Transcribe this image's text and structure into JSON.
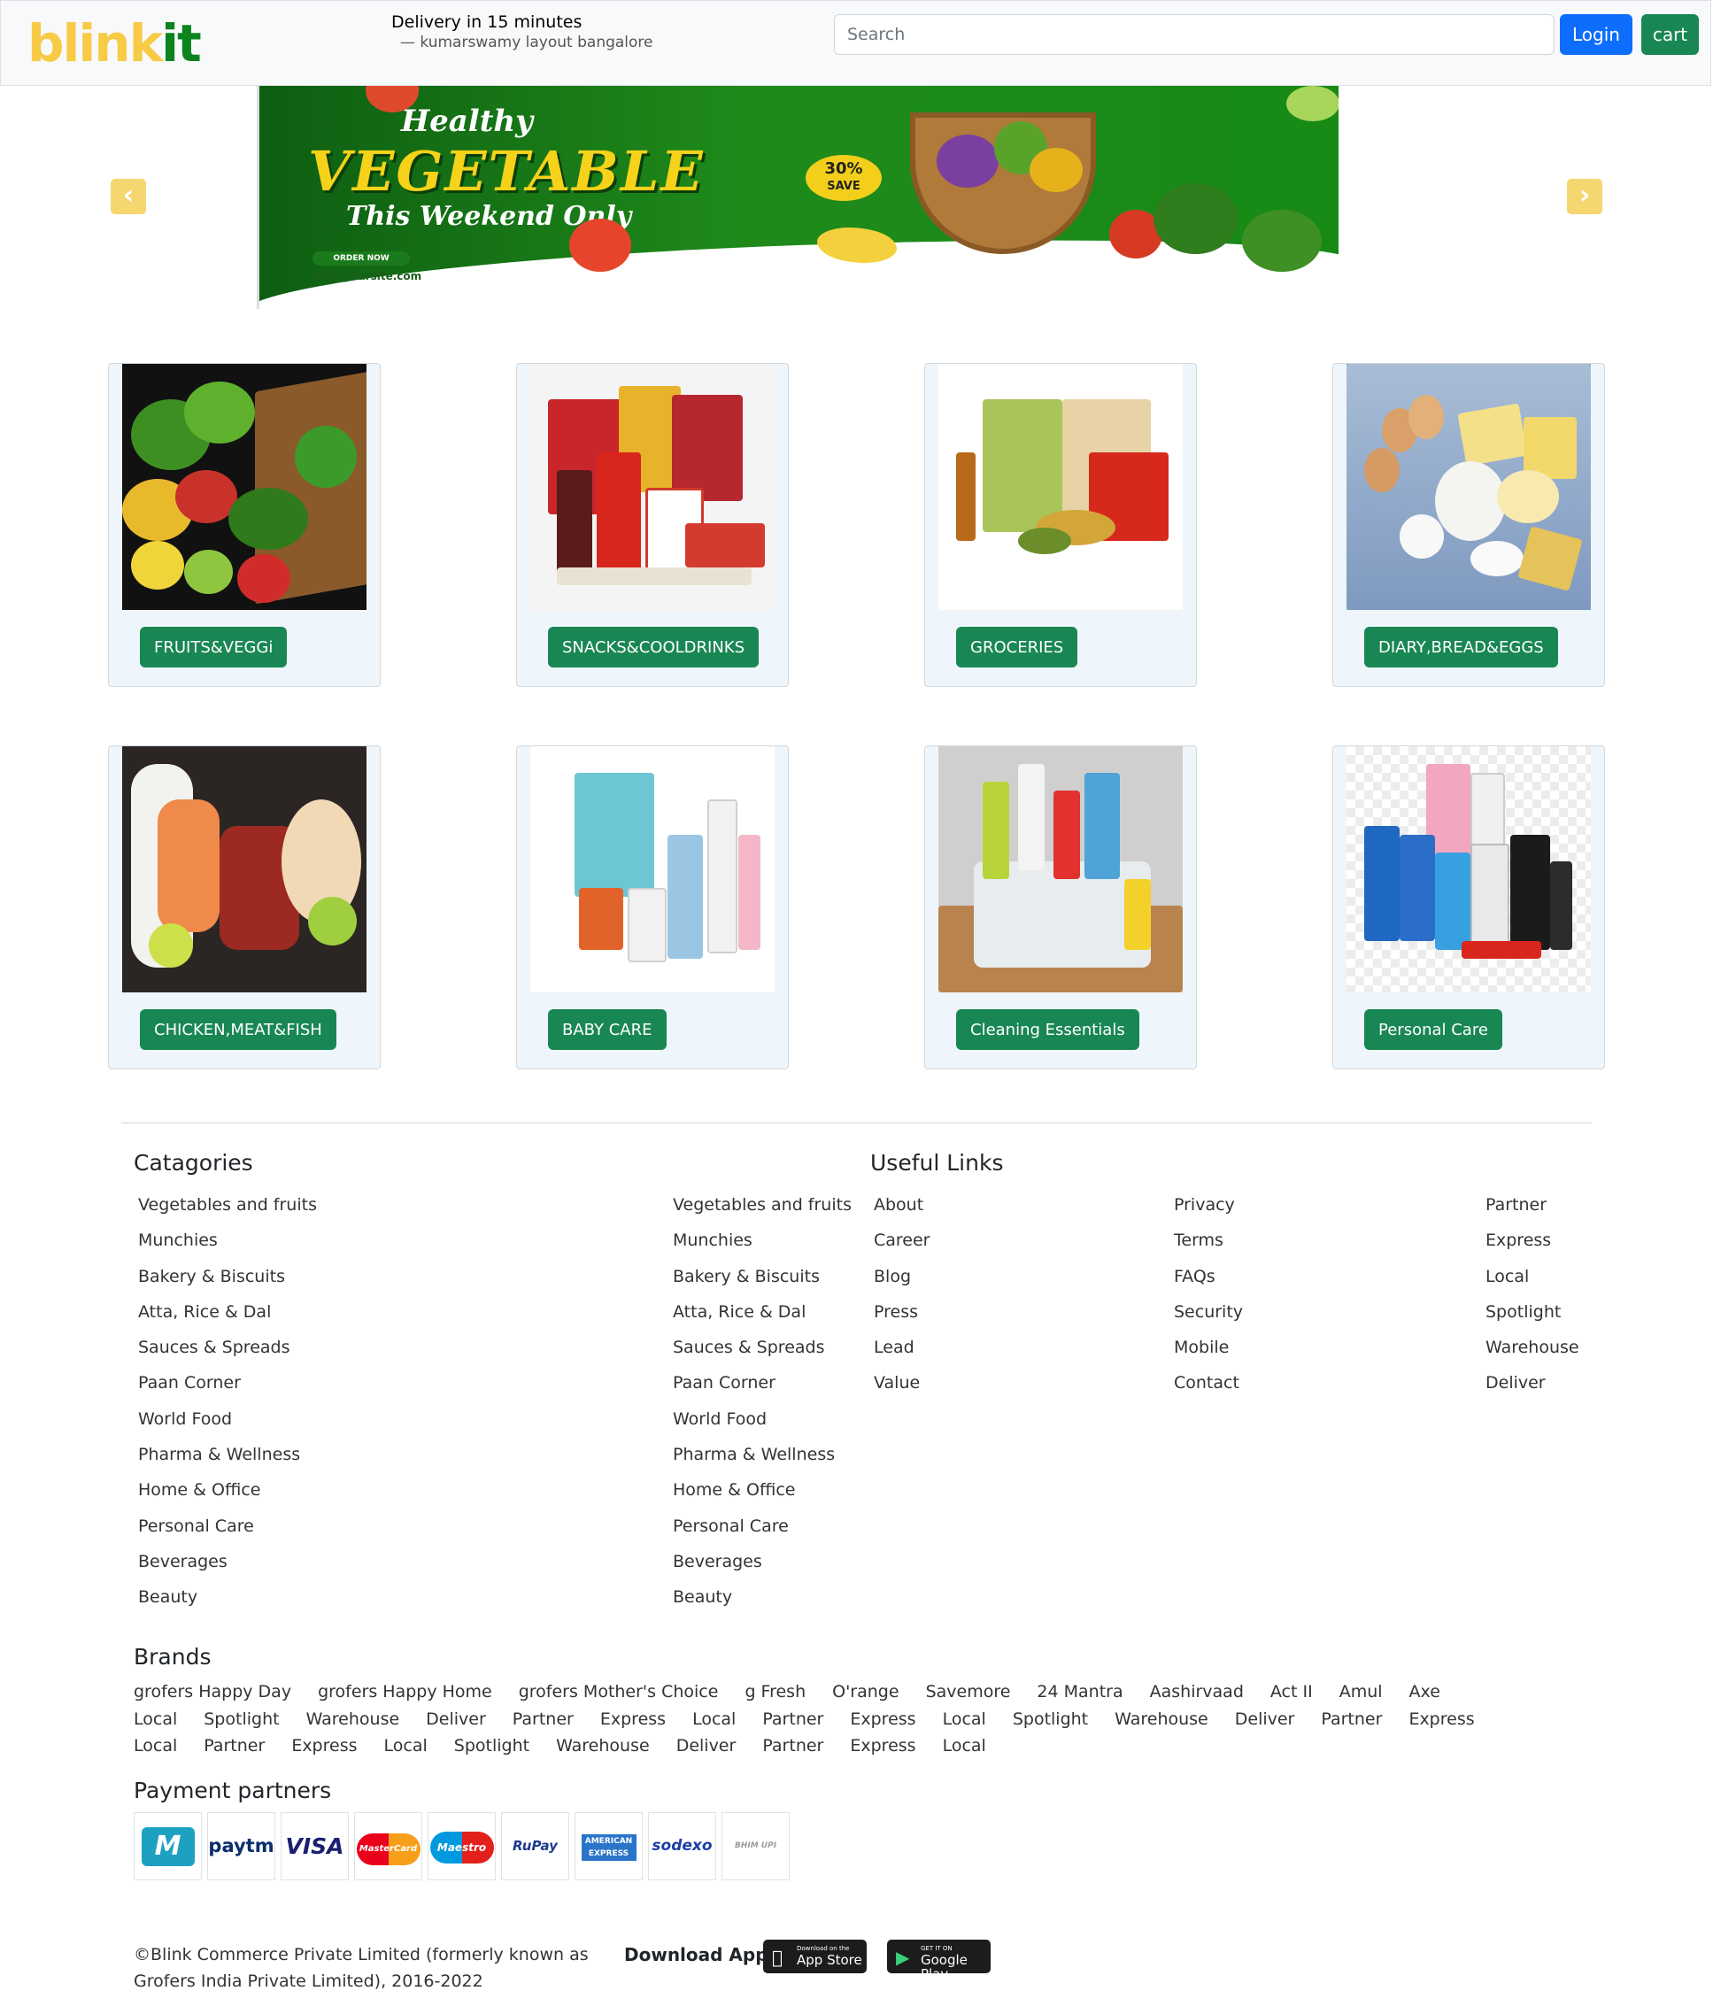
{
  "header": {
    "logo_part1": "blink",
    "logo_part2": "it",
    "delivery_title": "Delivery in 15 minutes",
    "delivery_location": "— kumarswamy layout bangalore",
    "search_placeholder": "Search",
    "login_label": "Login",
    "cart_label": "cart"
  },
  "carousel": {
    "prev_icon": "chevron-left-icon",
    "next_icon": "chevron-right-icon",
    "banner": {
      "script_title": "Healthy",
      "headline": "VEGETABLE",
      "subline": "This Weekend Only",
      "badge_top": "30%",
      "badge_bottom": "SAVE",
      "order_button": "ORDER NOW",
      "website": "www.yoursite.com"
    }
  },
  "categories": [
    {
      "label": "FRUITS&VEGGi"
    },
    {
      "label": "SNACKS&COOLDRINKS"
    },
    {
      "label": "GROCERIES"
    },
    {
      "label": "DIARY,BREAD&EGGS"
    },
    {
      "label": "CHICKEN,MEAT&FISH"
    },
    {
      "label": "BABY CARE"
    },
    {
      "label": "Cleaning Essentials"
    },
    {
      "label": "Personal Care"
    }
  ],
  "footer": {
    "categories_heading": "Catagories",
    "categories_col1": [
      "Vegetables and fruits",
      "Munchies",
      "Bakery & Biscuits",
      "Atta, Rice & Dal",
      "Sauces & Spreads",
      "Paan Corner",
      "World Food",
      "Pharma & Wellness",
      "Home & Office",
      "Personal Care",
      "Beverages",
      "Beauty"
    ],
    "categories_col2": [
      "Vegetables and fruits",
      "Munchies",
      "Bakery & Biscuits",
      "Atta, Rice & Dal",
      "Sauces & Spreads",
      "Paan Corner",
      "World Food",
      "Pharma & Wellness",
      "Home & Office",
      "Personal Care",
      "Beverages",
      "Beauty"
    ],
    "useful_heading": "Useful Links",
    "useful_col1": [
      "About",
      "Career",
      "Blog",
      "Press",
      "Lead",
      "Value"
    ],
    "useful_col2": [
      "Privacy",
      "Terms",
      "FAQs",
      "Security",
      "Mobile",
      "Contact"
    ],
    "useful_col3": [
      "Partner",
      "Express",
      "Local",
      "Spotlight",
      "Warehouse",
      "Deliver"
    ],
    "brands_heading": "Brands",
    "brands": [
      "grofers Happy Day",
      "grofers Happy Home",
      "grofers Mother's Choice",
      "g Fresh",
      "O'range",
      "Savemore",
      "24 Mantra",
      "Aashirvaad",
      "Act II",
      "Amul",
      "Axe",
      "Local",
      "Spotlight",
      "Warehouse",
      "Deliver",
      "Partner",
      "Express",
      "Local",
      "Partner",
      "Express",
      "Local",
      "Spotlight",
      "Warehouse",
      "Deliver",
      "Partner",
      "Express",
      "Local",
      "Partner",
      "Express",
      "Local",
      "Spotlight",
      "Warehouse",
      "Deliver",
      "Partner",
      "Express",
      "Local"
    ],
    "payment_heading": "Payment partners",
    "payment_partners": [
      "Mobikwik",
      "Paytm",
      "VISA",
      "MasterCard",
      "Maestro",
      "RuPay",
      "American Express",
      "sodexo",
      "BHIM UPI"
    ],
    "payment_labels": [
      "M",
      "paytm",
      "VISA",
      "MasterCard",
      "Maestro",
      "RuPay",
      "AMERICAN EXPRESS",
      "sodexo",
      "BHIM UPI"
    ],
    "copyright": "©Blink Commerce Private Limited (formerly known as Grofers India Private Limited), 2016-2022",
    "download_label": "Download App",
    "app_store_small": "Download on the",
    "app_store_big": "App Store",
    "google_play_small": "GET IT ON",
    "google_play_big": "Google Play"
  },
  "colors": {
    "primary_blue": "#0d6efd",
    "success_green": "#198754",
    "logo_yellow": "#f8cb46",
    "logo_green": "#0c831f",
    "card_bg": "#eef6fb"
  }
}
